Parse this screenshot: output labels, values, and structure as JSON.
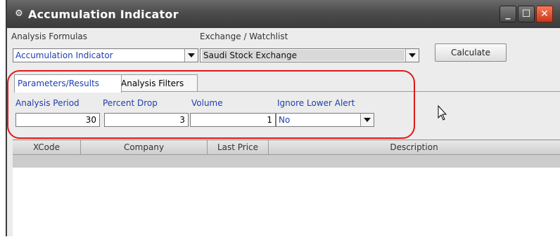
{
  "window": {
    "title": "Accumulation Indicator"
  },
  "analysis_formulas": {
    "label": "Analysis Formulas",
    "value": "Accumulation Indicator"
  },
  "exchange": {
    "label": "Exchange / Watchlist",
    "value": "Saudi Stock Exchange"
  },
  "calculate_label": "Calculate",
  "tabs": [
    {
      "label": "Parameters/Results",
      "active": true
    },
    {
      "label": "Analysis Filters",
      "active": false
    }
  ],
  "params": {
    "analysis_period": {
      "label": "Analysis Period",
      "value": "30"
    },
    "percent_drop": {
      "label": "Percent Drop",
      "value": "3"
    },
    "volume": {
      "label": "Volume",
      "value": "1"
    },
    "ignore_lower_alert": {
      "label": "Ignore Lower Alert",
      "value": "No"
    }
  },
  "table": {
    "columns": [
      "XCode",
      "Company",
      "Last Price",
      "Description"
    ],
    "rows": []
  },
  "colors": {
    "highlight_oval": "#e01818",
    "link_blue": "#1c3fae"
  }
}
